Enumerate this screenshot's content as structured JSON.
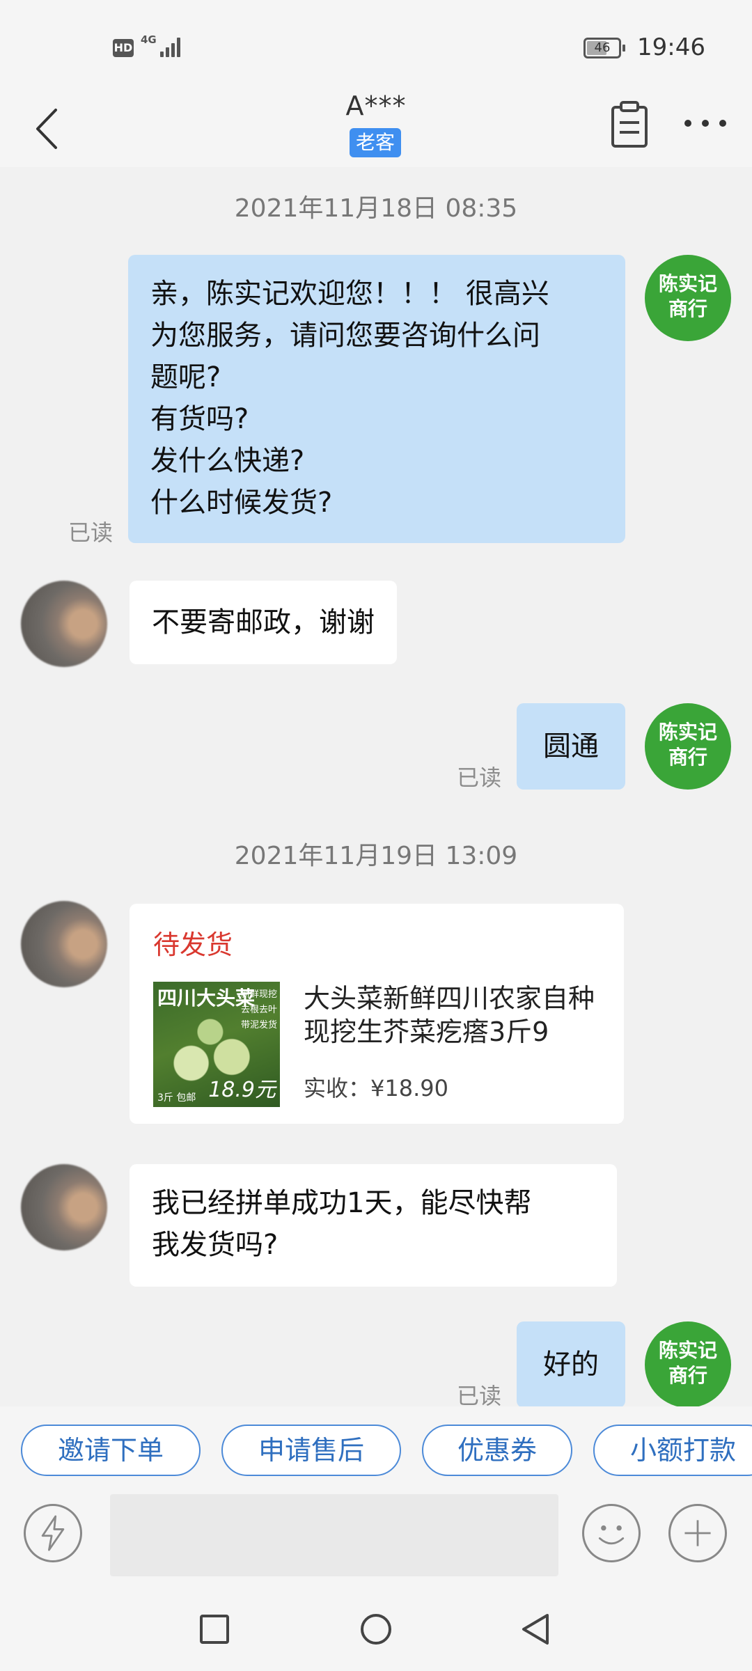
{
  "status_bar": {
    "hd": "HD",
    "network": "4G",
    "battery": "46",
    "time": "19:46"
  },
  "header": {
    "title": "A***",
    "tag": "老客"
  },
  "messages": {
    "ts1": "2021年11月18日 08:35",
    "m1_lines": [
      "亲，陈实记欢迎您！！！ 很高兴",
      "为您服务，请问您要咨询什么问",
      "题呢?",
      "有货吗?",
      "发什么快递?",
      "什么时候发货?"
    ],
    "read": "已读",
    "m2": "不要寄邮政，谢谢",
    "m3": "圆通",
    "ts2": "2021年11月19日 13:09",
    "order": {
      "status": "待发货",
      "image_title": "四川大头菜",
      "image_side": [
        "新鲜现挖",
        "去根去叶",
        "带泥发货"
      ],
      "image_price": "18.9元",
      "image_baoyou": "3斤 包邮",
      "name": "大头菜新鲜四川农家自种现挖生芥菜疙瘩3斤9",
      "price": "实收：¥18.90"
    },
    "m4_lines": [
      "我已经拼单成功1天，能尽快帮",
      "我发货吗?"
    ],
    "m5": "好的"
  },
  "shop_avatar": {
    "line1": "陈实记",
    "line2": "商行"
  },
  "quick_actions": [
    "邀请下单",
    "申请售后",
    "优惠券",
    "小额打款"
  ],
  "colors": {
    "out_bubble": "#c5e0f8",
    "tag": "#3f8ff0",
    "shop_avatar": "#3aa538",
    "order_status": "#d9382f"
  },
  "icons": [
    "back-arrow-icon",
    "notes-icon",
    "more-icon",
    "lightning-icon",
    "emoji-icon",
    "plus-icon",
    "nav-square-icon",
    "nav-circle-icon",
    "nav-back-icon"
  ]
}
